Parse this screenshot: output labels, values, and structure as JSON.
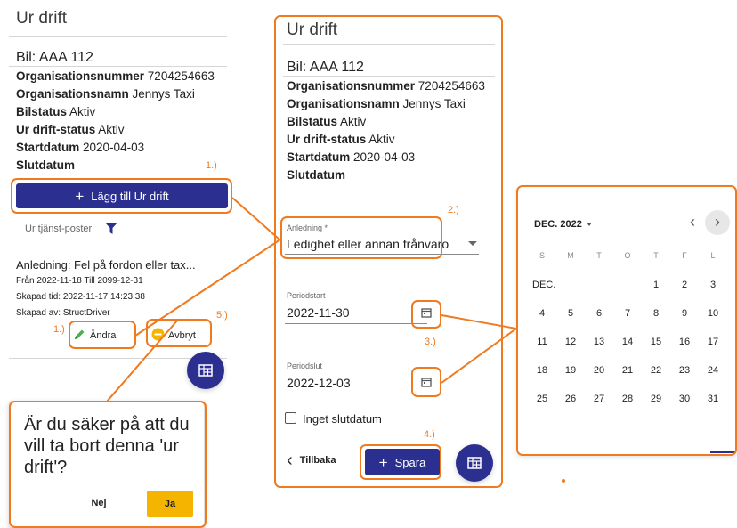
{
  "left_panel": {
    "title": "Ur drift",
    "bil": "Bil: AAA 112",
    "fields": [
      {
        "label": "Organisationsnummer",
        "value": "7204254663"
      },
      {
        "label": "Organisationsnamn",
        "value": "Jennys Taxi"
      },
      {
        "label": "Bilstatus",
        "value": "Aktiv"
      },
      {
        "label": "Ur drift-status",
        "value": "Aktiv"
      },
      {
        "label": "Startdatum",
        "value": "2020-04-03"
      },
      {
        "label": "Slutdatum",
        "value": ""
      }
    ],
    "add_button": "Lägg till Ur drift",
    "filter_label": "Ur tjänst-poster",
    "record": {
      "reason": "Anledning: Fel på fordon eller tax...",
      "period": "Från 2022-11-18 Till 2099-12-31",
      "created": "Skapad tid: 2022-11-17 14:23:38",
      "created_by": "Skapad av: StructDriver"
    },
    "edit_button": "Ändra",
    "cancel_button": "Avbryt"
  },
  "dialog": {
    "text": "Är du säker på att du vill ta bort denna 'ur drift'?",
    "no": "Nej",
    "yes": "Ja"
  },
  "form_panel": {
    "title": "Ur drift",
    "bil": "Bil: AAA 112",
    "fields": [
      {
        "label": "Organisationsnummer",
        "value": "7204254663"
      },
      {
        "label": "Organisationsnamn",
        "value": "Jennys Taxi"
      },
      {
        "label": "Bilstatus",
        "value": "Aktiv"
      },
      {
        "label": "Ur drift-status",
        "value": "Aktiv"
      },
      {
        "label": "Startdatum",
        "value": "2020-04-03"
      },
      {
        "label": "Slutdatum",
        "value": ""
      }
    ],
    "reason_label": "Anledning *",
    "reason_value": "Ledighet eller annan frånvaro",
    "start_label": "Periodstart",
    "start_value": "2022-11-30",
    "end_label": "Periodslut",
    "end_value": "2022-12-03",
    "no_end_label": "Inget slutdatum",
    "back_button": "Tillbaka",
    "save_button": "Spara"
  },
  "calendar": {
    "month": "DEC. 2022",
    "weekdays": [
      "S",
      "M",
      "T",
      "O",
      "T",
      "F",
      "L"
    ],
    "month_short": "DEC.",
    "days": [
      "1",
      "2",
      "3",
      "4",
      "5",
      "6",
      "7",
      "8",
      "9",
      "10",
      "11",
      "12",
      "13",
      "14",
      "15",
      "16",
      "17",
      "18",
      "19",
      "20",
      "21",
      "22",
      "23",
      "24",
      "25",
      "26",
      "27",
      "28",
      "29",
      "30",
      "31"
    ]
  },
  "steps": [
    "1.)",
    "1.)",
    "2.)",
    "3.)",
    "4.)",
    "5.)"
  ],
  "colors": {
    "accent": "#f07a1f",
    "primary": "#2b2f8f",
    "warning": "#f5b400"
  }
}
